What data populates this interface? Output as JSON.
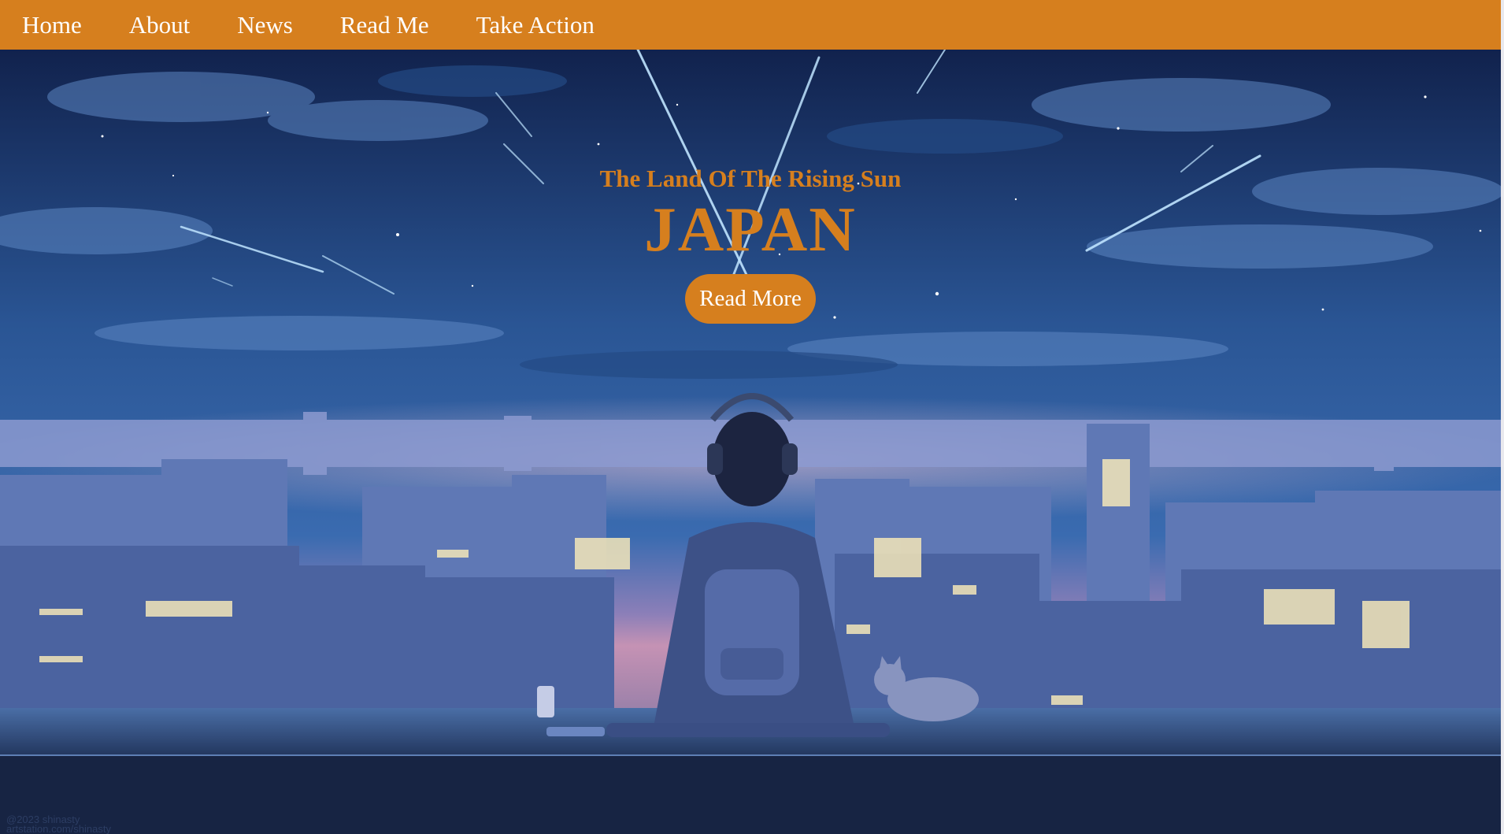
{
  "nav": {
    "items": [
      {
        "label": "Home"
      },
      {
        "label": "About"
      },
      {
        "label": "News"
      },
      {
        "label": "Read Me"
      },
      {
        "label": "Take Action"
      }
    ]
  },
  "hero": {
    "subtitle": "The Land Of The Rising Sun",
    "title": "JAPAN",
    "button_label": "Read More"
  },
  "credit": {
    "line1": "@2023 shinasty",
    "line2": "artstation.com/shinasty"
  },
  "colors": {
    "accent": "#d67f1e",
    "nav_text": "#ffffff",
    "sky_top": "#10214a",
    "sky_mid": "#2b5a9a",
    "city_glow": "#c27fa6"
  }
}
